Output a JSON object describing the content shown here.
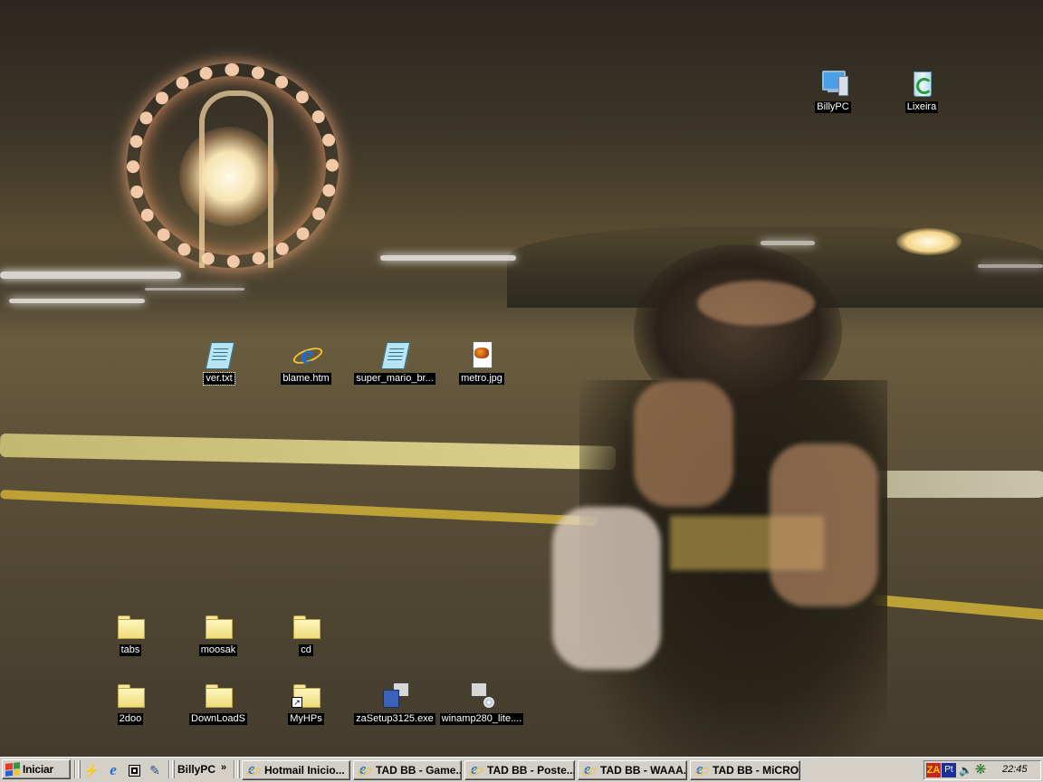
{
  "desktop": {
    "icons": [
      {
        "label": "BillyPC",
        "icon": "my-computer-icon"
      },
      {
        "label": "Lixeira",
        "icon": "recycle-bin-icon"
      },
      {
        "label": "ver.txt",
        "icon": "text-file-icon"
      },
      {
        "label": "blame.htm",
        "icon": "html-file-icon"
      },
      {
        "label": "super_mario_br...",
        "icon": "text-file-icon"
      },
      {
        "label": "metro.jpg",
        "icon": "image-file-icon"
      },
      {
        "label": "tabs",
        "icon": "folder-icon"
      },
      {
        "label": "moosak",
        "icon": "folder-icon"
      },
      {
        "label": "cd",
        "icon": "folder-icon"
      },
      {
        "label": "2doo",
        "icon": "folder-icon"
      },
      {
        "label": "DownLoadS",
        "icon": "folder-icon"
      },
      {
        "label": "MyHPs",
        "icon": "folder-shortcut-icon"
      },
      {
        "label": "zaSetup3125.exe",
        "icon": "installer-icon"
      },
      {
        "label": "winamp280_lite....",
        "icon": "installer-icon"
      }
    ]
  },
  "taskbar": {
    "start_label": "Iniciar",
    "quick_launch": [
      "winamp-icon",
      "internet-explorer-icon",
      "show-desktop-icon",
      "notepad-icon"
    ],
    "toolbar_name": "BillyPC",
    "toolbar_chevron": "»",
    "tasks": [
      {
        "title": "Hotmail Inicio..."
      },
      {
        "title": "TAD BB - Game..."
      },
      {
        "title": "TAD BB - Poste..."
      },
      {
        "title": "TAD BB - WAAA..."
      },
      {
        "title": "TAD BB - MiCRO..."
      }
    ],
    "tray": {
      "za_label": "ZA",
      "lang_label": "Pt",
      "icons": [
        "zonealarm-icon",
        "language-icon",
        "volume-icon",
        "network-icon"
      ],
      "clock": "22:45"
    },
    "colors": {
      "face": "#d4d0c8",
      "task_icon": "#1a6fd6"
    }
  }
}
